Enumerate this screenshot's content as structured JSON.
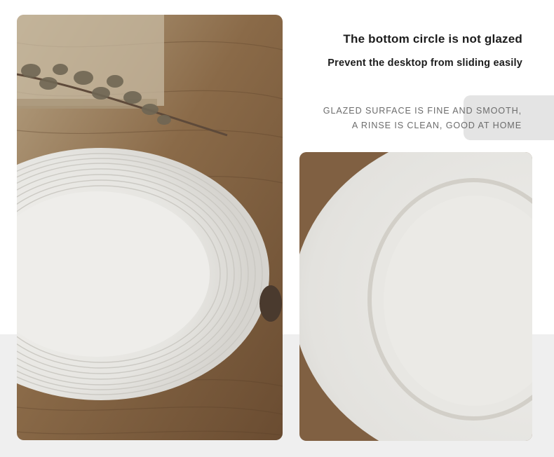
{
  "heading": {
    "title": "The bottom circle is not glazed",
    "subtitle": "Prevent the desktop from sliding easily"
  },
  "description": {
    "line1": "GLAZED SURFACE IS FINE AND SMOOTH,",
    "line2": "A RINSE IS CLEAN, GOOD AT HOME"
  },
  "colors": {
    "background": "#ffffff",
    "band": "#efefef",
    "tab": "#e4e4e4",
    "wood": "#8a6a48",
    "plate": "#ecebe7",
    "title_text": "#1c1c1c",
    "desc_text": "#6c6c6c"
  }
}
